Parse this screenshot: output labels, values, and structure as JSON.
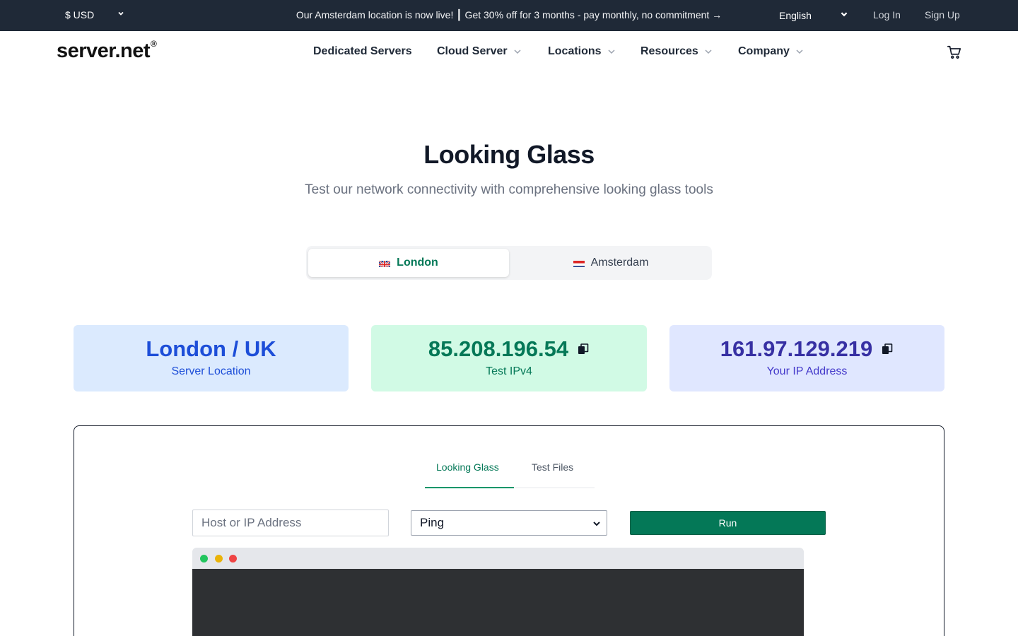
{
  "topbar": {
    "currency": "$ USD",
    "announcement": "Our Amsterdam location is now live! ┃ Get 30% off for 3 months - pay monthly, no commitment →",
    "language": "English",
    "login": "Log In",
    "signup": "Sign Up",
    "background": "#1f2937"
  },
  "nav": {
    "logo": "server.net",
    "logo_mark": "®",
    "items": [
      {
        "label": "Dedicated Servers",
        "has_dropdown": false
      },
      {
        "label": "Cloud Server",
        "has_dropdown": true
      },
      {
        "label": "Locations",
        "has_dropdown": true
      },
      {
        "label": "Resources",
        "has_dropdown": true
      },
      {
        "label": "Company",
        "has_dropdown": true
      }
    ],
    "cart_icon": "shopping-cart-icon"
  },
  "hero": {
    "title": "Looking Glass",
    "subtitle": "Test our network connectivity with comprehensive looking glass tools"
  },
  "location_tabs": [
    {
      "label": "London",
      "flag": "uk-flag-icon",
      "active": true
    },
    {
      "label": "Amsterdam",
      "flag": "nl-flag-icon",
      "active": false
    }
  ],
  "cards": [
    {
      "value": "London / UK",
      "label": "Server Location",
      "background": "#dbeafe",
      "color": "#1d4ed8"
    },
    {
      "value": "85.208.196.54",
      "label": "Test IPv4",
      "background": "#d1fae5",
      "color": "#047857",
      "copy_icon": "copy-icon"
    },
    {
      "value": "161.97.129.219",
      "label": "Your IP Address",
      "background": "#e0e7ff",
      "color": "#3730a3",
      "copy_icon": "copy-icon"
    }
  ],
  "tool": {
    "tabs": [
      {
        "label": "Looking Glass",
        "active": true
      },
      {
        "label": "Test Files",
        "active": false
      }
    ],
    "host_placeholder": "Host or IP Address",
    "host_value": "",
    "method_selected": "Ping",
    "run_label": "Run",
    "accent": "#047857"
  }
}
